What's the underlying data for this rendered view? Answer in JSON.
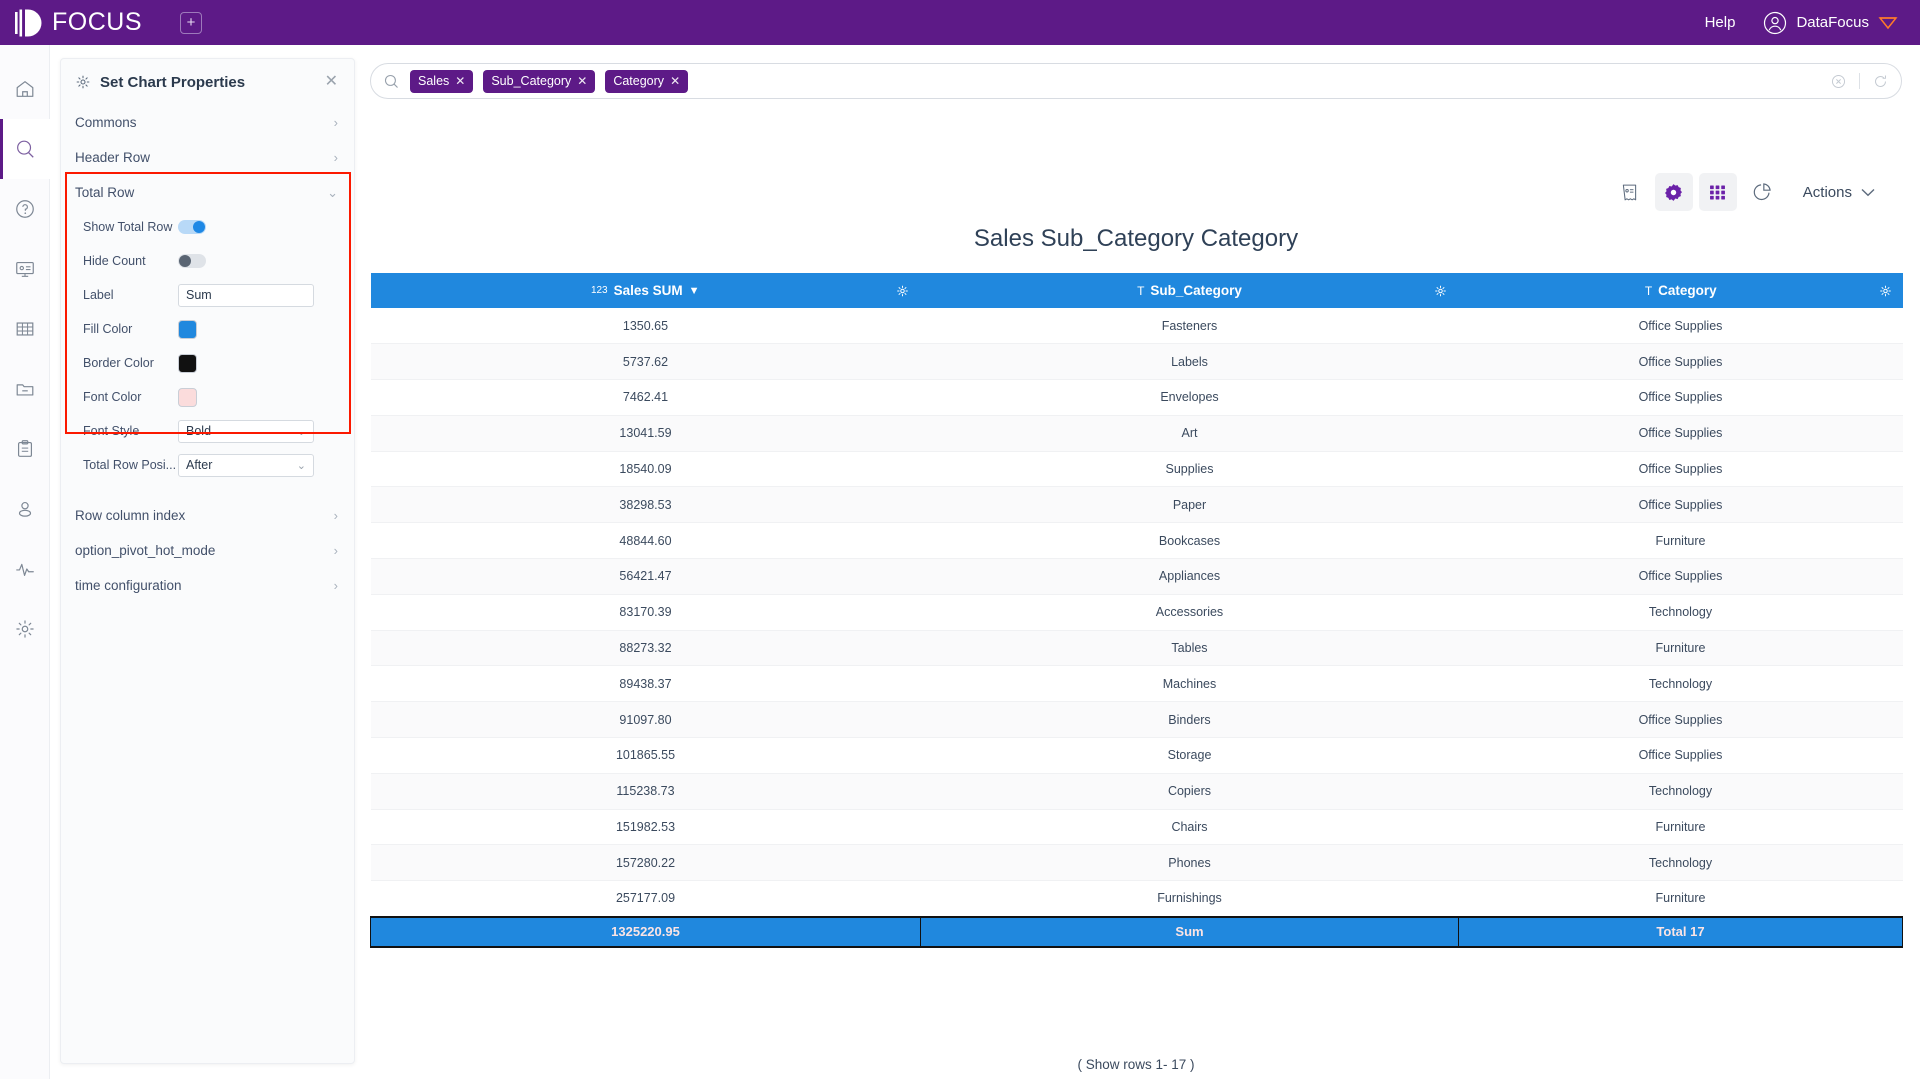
{
  "topbar": {
    "brand": "FOCUS",
    "add_tab_icon": "plus-square-icon",
    "help": "Help",
    "user": "DataFocus",
    "user_icon": "user-circle-icon",
    "gem_icon": "gem-icon",
    "bg_color": "#5d1a87"
  },
  "rail": {
    "items": [
      {
        "icon": "home-icon",
        "name": "home",
        "active": false
      },
      {
        "icon": "search-icon",
        "name": "search",
        "active": true
      },
      {
        "icon": "question-circle-icon",
        "name": "help",
        "active": false
      },
      {
        "icon": "presentation-icon",
        "name": "dashboard",
        "active": false
      },
      {
        "icon": "table-grid-icon",
        "name": "data-table",
        "active": false
      },
      {
        "icon": "folder-minus-icon",
        "name": "folder",
        "active": false
      },
      {
        "icon": "clipboard-icon",
        "name": "clipboard",
        "active": false
      },
      {
        "icon": "user-icon",
        "name": "user",
        "active": false
      },
      {
        "icon": "activity-pulse-icon",
        "name": "monitor",
        "active": false
      },
      {
        "icon": "gear-icon",
        "name": "settings",
        "active": false
      }
    ]
  },
  "panel": {
    "title": "Set Chart Properties",
    "gear_icon": "gear-icon",
    "close_icon": "close-icon",
    "sections_before": [
      {
        "label": "Commons",
        "chevron": "›"
      },
      {
        "label": "Header Row",
        "chevron": "›"
      }
    ],
    "total_row": {
      "label": "Total Row",
      "chevron": "⌄",
      "fields": {
        "show_total_row": {
          "label": "Show Total Row",
          "value": "on"
        },
        "hide_count": {
          "label": "Hide Count",
          "value": "off"
        },
        "label": {
          "label": "Label",
          "value": "Sum",
          "placeholder": "Sum"
        },
        "fill_color": {
          "label": "Fill Color",
          "value": "#2088de"
        },
        "border_color": {
          "label": "Border Color",
          "value": "#111111"
        },
        "font_color": {
          "label": "Font Color",
          "value": "#fbdcdc"
        },
        "font_style": {
          "label": "Font Style",
          "value": "Bold",
          "chevron": "⌄"
        },
        "total_row_position": {
          "label": "Total Row Posi...",
          "value": "After",
          "chevron": "⌄"
        }
      }
    },
    "sections_after": [
      {
        "label": "Row column index",
        "chevron": "›"
      },
      {
        "label": "option_pivot_hot_mode",
        "chevron": "›"
      },
      {
        "label": "time configuration",
        "chevron": "›"
      }
    ],
    "highlight_color": "#fb1900"
  },
  "search": {
    "search_icon": "search-icon",
    "tags": [
      {
        "label": "Sales",
        "close": "✕"
      },
      {
        "label": "Sub_Category",
        "close": "✕"
      },
      {
        "label": "Category",
        "close": "✕"
      }
    ],
    "clear_icon": "clear-circle-icon",
    "refresh_icon": "refresh-icon"
  },
  "toolbar": {
    "buttons": [
      {
        "icon": "receipt-icon",
        "name": "receipt",
        "active": false
      },
      {
        "icon": "gear-icon",
        "name": "chart-properties",
        "active": true
      },
      {
        "icon": "grid-icon",
        "name": "table-view",
        "active": true
      },
      {
        "icon": "pie-chart-icon",
        "name": "chart-type",
        "active": false
      }
    ],
    "actions_label": "Actions",
    "actions_chevron": "⌄"
  },
  "chart": {
    "title": "Sales Sub_Category Category",
    "footer": "( Show rows 1- 17 )"
  },
  "chart_data": {
    "type": "table",
    "title": "Sales Sub_Category Category",
    "columns": [
      {
        "label": "Sales SUM",
        "type_icon": "123",
        "sort": "▼",
        "gear": "gear-icon"
      },
      {
        "label": "Sub_Category",
        "type_icon": "T",
        "sort": "",
        "gear": "gear-icon"
      },
      {
        "label": "Category",
        "type_icon": "T",
        "sort": "",
        "gear": "gear-icon"
      }
    ],
    "rows": [
      [
        "1350.65",
        "Fasteners",
        "Office Supplies"
      ],
      [
        "5737.62",
        "Labels",
        "Office Supplies"
      ],
      [
        "7462.41",
        "Envelopes",
        "Office Supplies"
      ],
      [
        "13041.59",
        "Art",
        "Office Supplies"
      ],
      [
        "18540.09",
        "Supplies",
        "Office Supplies"
      ],
      [
        "38298.53",
        "Paper",
        "Office Supplies"
      ],
      [
        "48844.60",
        "Bookcases",
        "Furniture"
      ],
      [
        "56421.47",
        "Appliances",
        "Office Supplies"
      ],
      [
        "83170.39",
        "Accessories",
        "Technology"
      ],
      [
        "88273.32",
        "Tables",
        "Furniture"
      ],
      [
        "89438.37",
        "Machines",
        "Technology"
      ],
      [
        "91097.80",
        "Binders",
        "Office Supplies"
      ],
      [
        "101865.55",
        "Storage",
        "Office Supplies"
      ],
      [
        "115238.73",
        "Copiers",
        "Technology"
      ],
      [
        "151982.53",
        "Chairs",
        "Furniture"
      ],
      [
        "157280.22",
        "Phones",
        "Technology"
      ],
      [
        "257177.09",
        "Furnishings",
        "Furniture"
      ]
    ],
    "total_row": [
      "1325220.95",
      "Sum",
      "Total 17"
    ],
    "header_bg": "#2088de",
    "total_bg": "#2088de",
    "total_font_color": "#fbdcdc",
    "total_border_color": "#111111"
  }
}
